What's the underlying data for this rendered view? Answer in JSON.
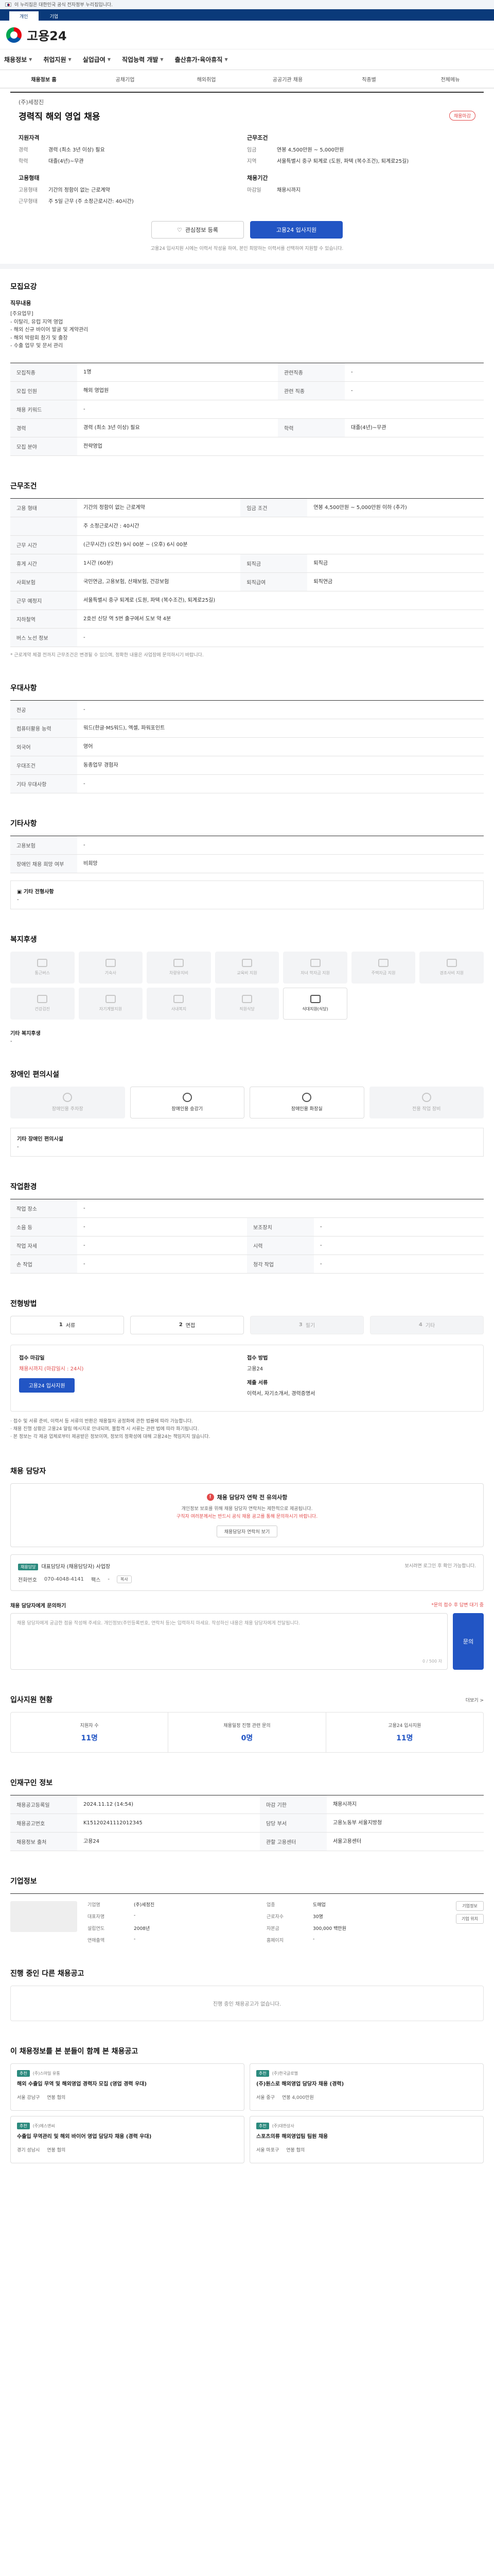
{
  "gov_bar": {
    "text": "이 누리집은 대한민국 공식 전자정부 누리집입니다."
  },
  "sub_tabs": [
    "개인",
    "기업"
  ],
  "logo": {
    "text": "고용24"
  },
  "gnb": [
    "채용정보",
    "취업지원",
    "실업급여",
    "직업능력 개발",
    "출산휴가·육아휴직"
  ],
  "snb": [
    "채용정보 홈",
    "공채기업",
    "해외취업",
    "공공기관 채용",
    "직종별",
    "전체메뉴"
  ],
  "job": {
    "company": "(주)세정진",
    "title": "경력직 해외 영업 채용",
    "dday": "채용마감",
    "qualification_title": "지원자격",
    "qualification": [
      {
        "k": "경력",
        "v": "경력 (최소 3년 이상) 필요"
      },
      {
        "k": "학력",
        "v": "대졸(4년)~무관"
      }
    ],
    "condition_title": "근무조건",
    "condition": [
      {
        "k": "임금",
        "v": "연봉 4,500만원 ~ 5,000만원"
      },
      {
        "k": "지역",
        "v": "서울특별시 중구 퇴계로 (도원, 파텍 (복수조건), 퇴계로25길)"
      }
    ],
    "type_title": "고용형태",
    "type": [
      {
        "k": "고용형태",
        "v": "기간의 정함이 없는 근로계약"
      },
      {
        "k": "근무형태",
        "v": "주 5일 근무 (주 소정근로시간: 40시간)"
      }
    ],
    "period_title": "채용기간",
    "period": [
      {
        "k": "마감일",
        "v": "채용시까지"
      }
    ],
    "btn_scrap": "관심정보 등록",
    "btn_apply": "고용24 입사지원",
    "note": "고용24 입사지원 시에는 이력서 작성을 하여, 본인 희망하는 이력서를 선택하여 지원할 수 있습니다."
  },
  "recruit": {
    "title": "모집요강",
    "duty_title": "직무내용",
    "duty_lines": [
      "[주요업무]",
      "- 이탈리, 유럽 지역 영업",
      "- 해외 신규 바이어 발굴 및 계약관리",
      "- 해외 박람회 참가 및 출장",
      "- 수출 업무 및 문서 관리"
    ],
    "rows": [
      {
        "k": "모집직종",
        "v": "1명",
        "k2": "관련직종",
        "v2": "-"
      },
      {
        "k": "모집 인원",
        "v": "해외 영업원",
        "k2": "관련 직종",
        "v2": "-"
      },
      {
        "k": "채용 키워드",
        "v": "-",
        "k2": "",
        "v2": ""
      },
      {
        "k": "경력",
        "v": "경력 (최소 3년 이상) 필요",
        "k2": "학력",
        "v2": "대졸(4년)~무관"
      },
      {
        "k": "모집 분야",
        "v": "전략영업",
        "k2": "",
        "v2": ""
      }
    ]
  },
  "work": {
    "title": "근무조건",
    "rows": [
      {
        "k": "고용 형태",
        "v": "기간의 정함이 없는 근로계약",
        "k2": "임금 조건",
        "v2": "연봉 4,500만원 ~ 5,000만원 이하 (추가)"
      },
      {
        "k": "",
        "v": "주 소정근로시간 : 40시간",
        "k2": "",
        "v2": ""
      },
      {
        "k": "근무 시간",
        "v": "(근무시간) (오전) 9시 00분 ~ (오후) 6시 00분",
        "k2": "",
        "v2": ""
      },
      {
        "k": "휴게 시간",
        "v": "1시간 (60분)",
        "k2": "퇴직금",
        "v2": "퇴직금"
      },
      {
        "k": "사회보험",
        "v": "국민연금, 고용보험, 산재보험, 건강보험",
        "k2": "퇴직급여",
        "v2": "퇴직연금"
      },
      {
        "k": "근무 예정지",
        "v": "서울특별시 중구 퇴계로 (도원, 파텍 (복수조건), 퇴계로25길)",
        "k2": "",
        "v2": ""
      },
      {
        "k": "지하철역",
        "v": "2호선 신당 역 5번 출구에서 도보 약 4분",
        "k2": "",
        "v2": ""
      },
      {
        "k": "버스 노선 정보",
        "v": "-",
        "k2": "",
        "v2": ""
      }
    ],
    "note": "* 근로계약 체결 전까지 근무조건은 변경될 수 있으며, 정확한 내용은 사업장에 문의하시기 바랍니다."
  },
  "prefer": {
    "title": "우대사항",
    "rows": [
      {
        "k": "전공",
        "v": "-"
      },
      {
        "k": "컴퓨터활용 능력",
        "v": "워드(한글·MS워드), 엑셀, 파워포인트"
      },
      {
        "k": "외국어",
        "v": "영어"
      },
      {
        "k": "우대조건",
        "v": "동종업무 경험자"
      },
      {
        "k": "기타 우대사항",
        "v": "-"
      }
    ]
  },
  "etc": {
    "title": "기타사항",
    "rows": [
      {
        "k": "고용보험",
        "v": "-"
      },
      {
        "k": "장애인 채용 희망 여부",
        "v": "비희망"
      }
    ],
    "extra_title": "▣ 기타 전형사항",
    "extra_value": "-"
  },
  "welfare": {
    "title": "복지후생",
    "items": [
      "통근버스",
      "기숙사",
      "차량유지비",
      "교육비 지원",
      "자녀 학자금 지원",
      "주택자금 지원",
      "경조사비 지원",
      "건강검진",
      "자기계발지원",
      "사내복지",
      "직원식당",
      "식대지원(식당)"
    ],
    "on_index": 11,
    "etc_label": "기타 복지후생",
    "etc_value": "-"
  },
  "disability": {
    "title": "장애인 편의시설",
    "items": [
      "장애인용 주차장",
      "장애인용 승강기",
      "장애인용 화장실",
      "전용 작업 장비"
    ],
    "on": [
      false,
      true,
      true,
      false
    ],
    "etc_label": "기타 장애인 편의시설",
    "etc_value": "-"
  },
  "work_env": {
    "title": "작업환경",
    "rows": [
      {
        "k": "작업 장소",
        "v": "-",
        "k2": "",
        "v2": ""
      },
      {
        "k": "소음 등",
        "v": "-",
        "k2": "보조장치",
        "v2": "-"
      },
      {
        "k": "작업 자세",
        "v": "-",
        "k2": "시력",
        "v2": "-"
      },
      {
        "k": "손 작업",
        "v": "-",
        "k2": "청각 작업",
        "v2": "-"
      }
    ]
  },
  "process": {
    "title": "전형방법",
    "steps": [
      {
        "n": "1",
        "label": "서류",
        "on": true
      },
      {
        "n": "2",
        "label": "면접",
        "on": true
      },
      {
        "n": "3",
        "label": "필기",
        "on": false
      },
      {
        "n": "4",
        "label": "기타",
        "on": false
      }
    ],
    "apply_method_label": "접수 마감일",
    "apply_method_value": "채용시까지 (마감일시 : 24시)",
    "apply_btn": "고용24 입사지원",
    "apply_way_label": "접수 방법",
    "apply_way_value": "고용24",
    "docs_label": "제출 서류",
    "docs_value": "이력서, 자기소개서, 경력증명서",
    "notes": [
      "· 접수 및 서류 준비, 이력서 등 서류의 반환은 채용절차 공정화에 관한 법률에 따라 가능합니다.",
      "· 채용 진행 상황은 고용24 알림 메시지로 안내되며, 불합격 시 서류는 관련 법에 따라 파기됩니다.",
      "· 본 정보는 각 제공 업체로부터 제공받은 정보이며, 정보의 정확성에 대해 고용24는 책임지지 않습니다."
    ]
  },
  "manager": {
    "title": "채용 담당자",
    "warn_title": "채용 담당자 연락 전 유의사항",
    "warn_text_1": "개인정보 보호를 위해 채용 담당자 연락처는 제한적으로 제공됩니다.",
    "warn_text_2": "구직자 여러분께서는 반드시 공식 채용 공고를 통해 문의하시기 바랍니다.",
    "warn_btn": "채용담당자 연락처 보기",
    "badge": "채용담당",
    "name": "대표담당자 (채용담당자) 사업장",
    "phone_label": "전화번호",
    "phone": "070-4048-4141",
    "fax_label": "팩스",
    "fax": "-",
    "copy_btn": "복사",
    "right_note": "보시려면 로그인 후 확인 가능합니다.",
    "qa_label": "채용 담당자에게 문의하기",
    "qa_right": "*문의 접수 후 답변 대기 중",
    "qa_placeholder": "채용 담당자에게 궁금한 점을 작성해 주세요. 개인정보(주민등록번호, 연락처 등)는 입력하지 마세요. 작성하신 내용은 채용 담당자에게 전달됩니다.",
    "qa_count": "0 / 500 자",
    "qa_submit": "문의"
  },
  "stats": {
    "title": "입사지원 현황",
    "more": "더보기 >",
    "items": [
      {
        "label": "지원자 수",
        "value": "11명"
      },
      {
        "label": "채용일정 진행 관련 문의",
        "value": "0명"
      },
      {
        "label": "고용24 입사지원",
        "value": "11명"
      }
    ]
  },
  "reg_info": {
    "title": "인재구인 정보",
    "rows": [
      {
        "k": "채용공고등록일",
        "v": "2024.11.12 (14:54)",
        "k2": "마감 기한",
        "v2": "채용시까지"
      },
      {
        "k": "채용공고번호",
        "v": "K15120241112012345",
        "k2": "담당 부서",
        "v2": "고용노동부 서울지방청"
      },
      {
        "k": "채용정보 출처",
        "v": "고용24",
        "k2": "관할 고용센터",
        "v2": "서울고용센터"
      }
    ]
  },
  "company": {
    "title": "기업정보",
    "rows": [
      {
        "k": "기업명",
        "v": "(주)세정진"
      },
      {
        "k": "업종",
        "v": "도매업"
      },
      {
        "k": "대표자명",
        "v": "-"
      },
      {
        "k": "근로자수",
        "v": "30명"
      },
      {
        "k": "설립연도",
        "v": "2008년"
      },
      {
        "k": "자본금",
        "v": "300,000 백만원"
      },
      {
        "k": "연매출액",
        "v": "-"
      },
      {
        "k": "홈페이지",
        "v": "-"
      }
    ],
    "btn1": "기업정보",
    "btn2": "기업 위치"
  },
  "other_jobs": {
    "title": "진행 중인 다른 채용공고",
    "empty": "진행 중인 채용공고가 없습니다."
  },
  "recommend": {
    "title": "이 채용정보를 본 분들이 함께 본 채용공고",
    "cards": [
      {
        "tag": "추천",
        "company": "(주)스마일 유통",
        "title": "해외 수출입 무역 및 해외영업 경력자 모집 (영업 경력 우대)",
        "region": "서울 강남구",
        "wage": "연봉 협의"
      },
      {
        "tag": "추천",
        "company": "(주)한국글로벌",
        "title": "(주)원스로 해외영업 담당자 채용 (경력)",
        "region": "서울 중구",
        "wage": "연봉 4,000만원"
      },
      {
        "tag": "추천",
        "company": "(주)에스앤씨",
        "title": "수출입 무역관리 및 해외 바이어 영업 담당자 채용 (경력 우대)",
        "region": "경기 성남시",
        "wage": "연봉 협의"
      },
      {
        "tag": "추천",
        "company": "(주)대한상사",
        "title": "스포츠의류 해외영업팀 팀원 채용",
        "region": "서울 마포구",
        "wage": "연봉 협의"
      }
    ]
  }
}
